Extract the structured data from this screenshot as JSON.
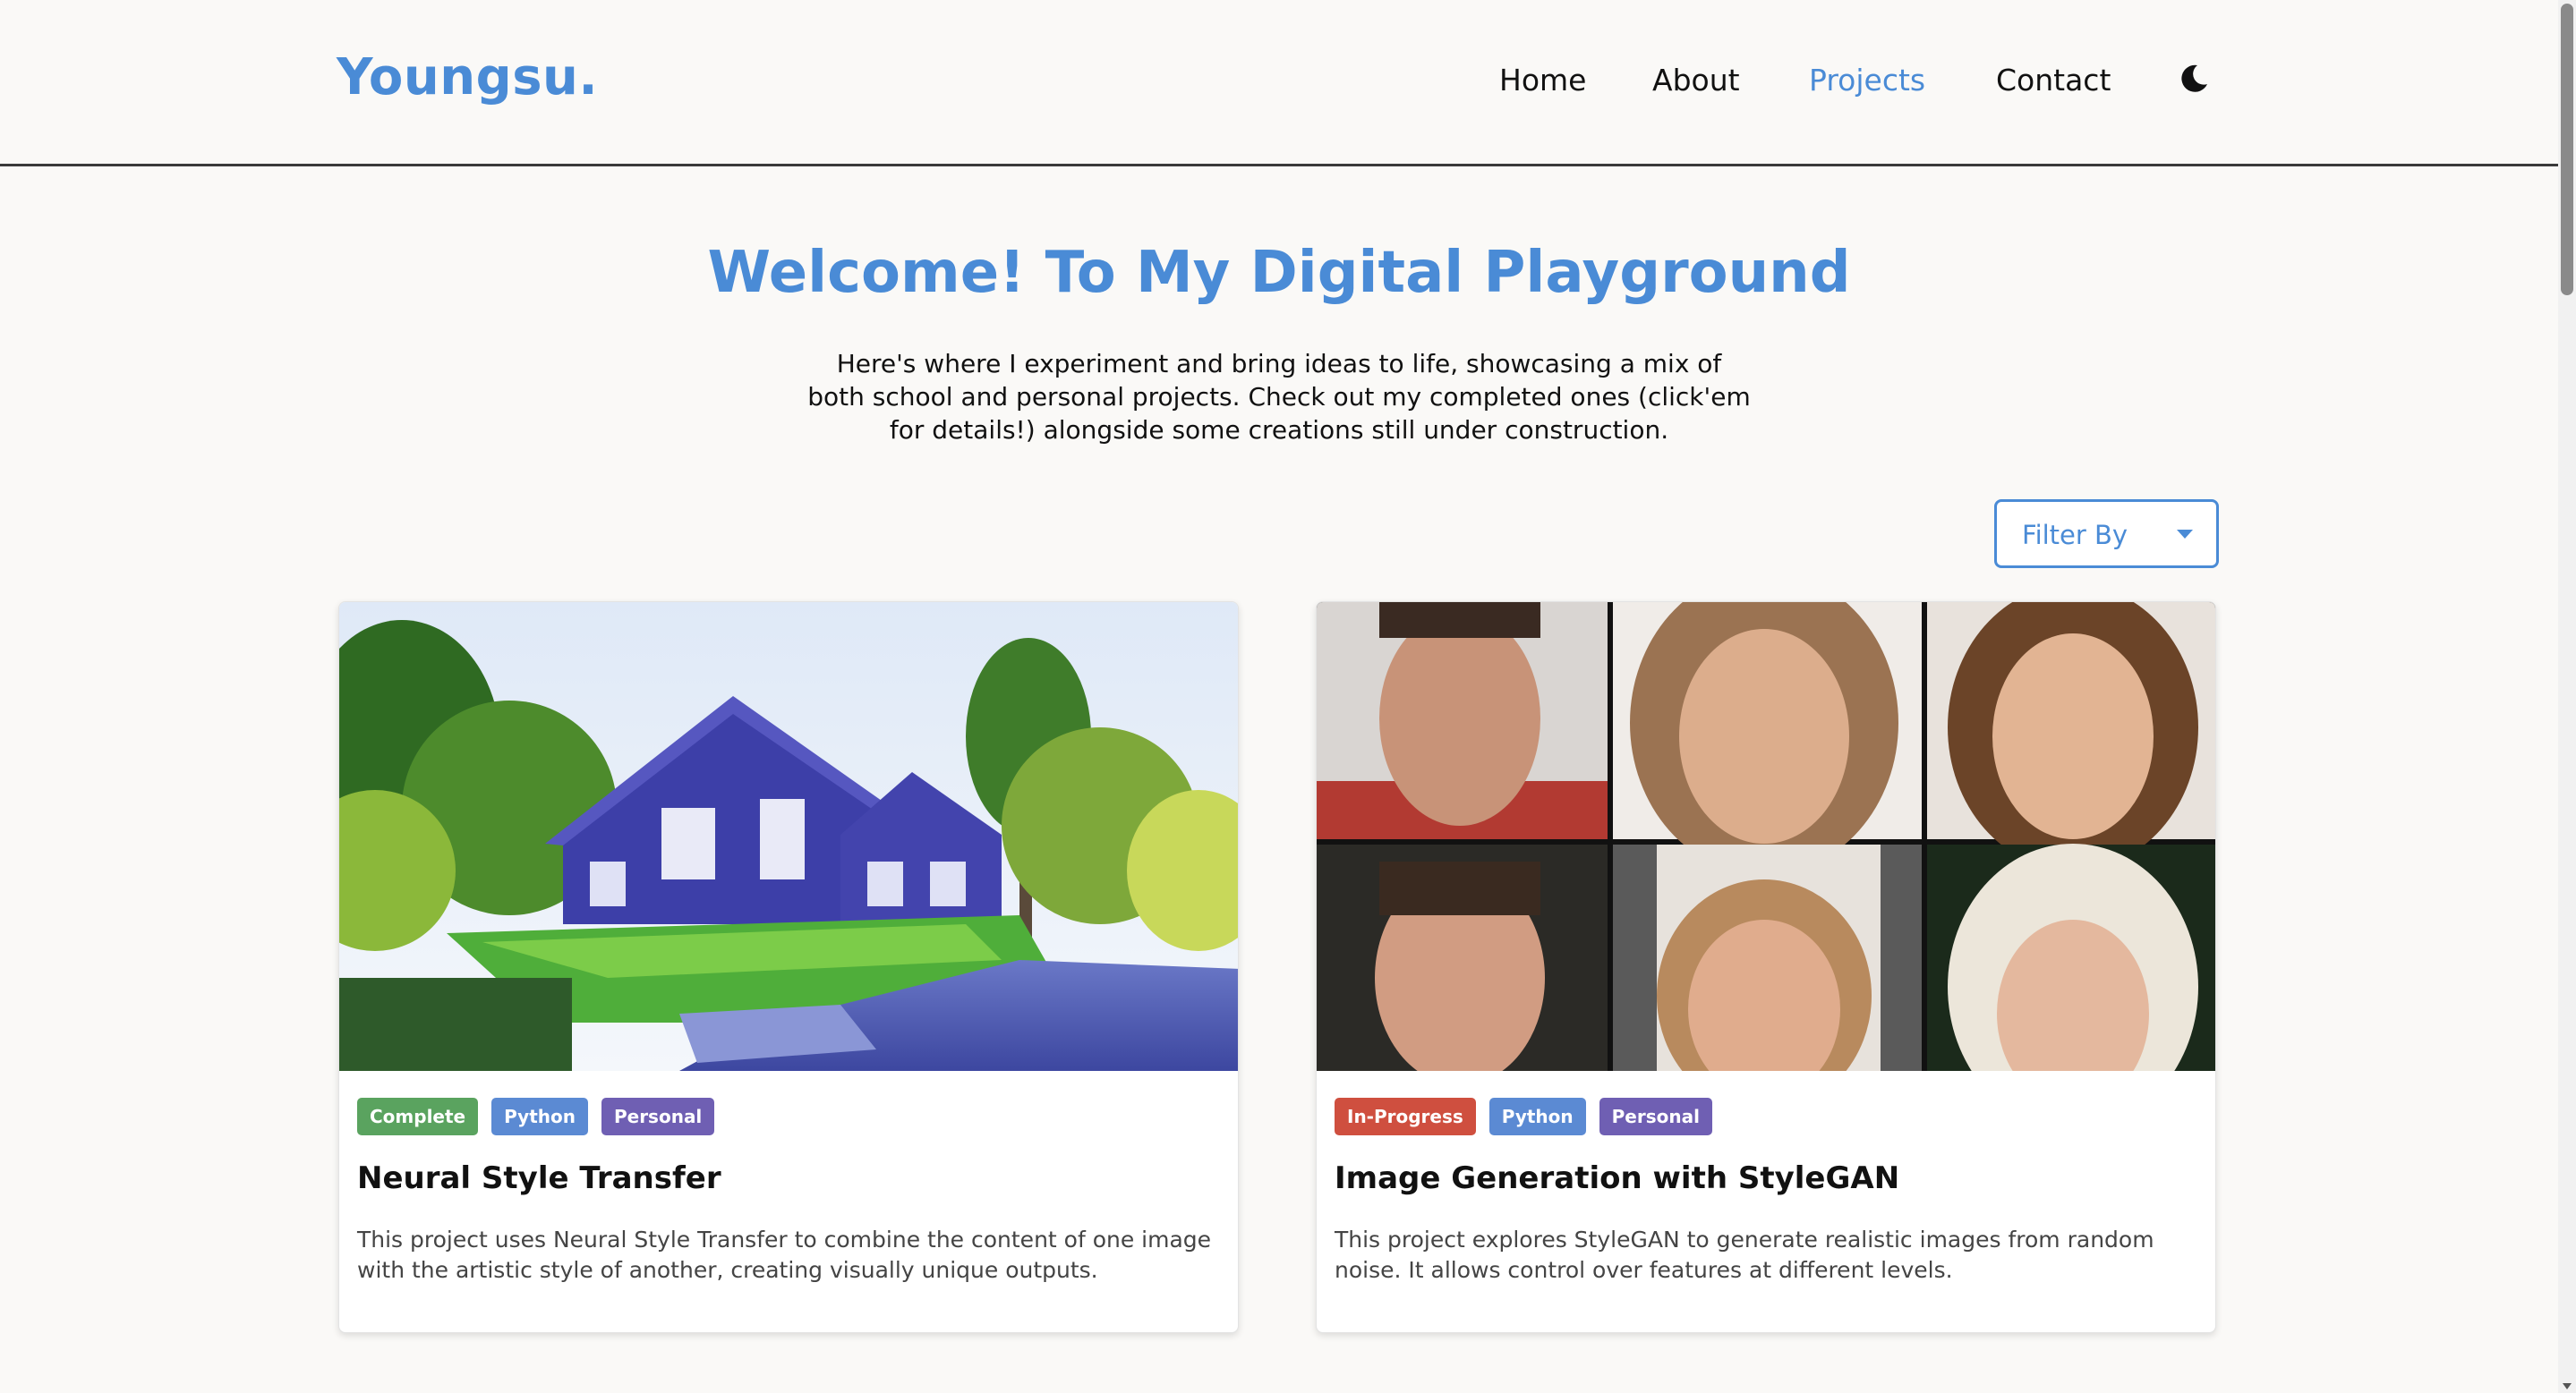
{
  "nav": {
    "brand": "Youngsu.",
    "links": [
      {
        "label": "Home"
      },
      {
        "label": "About"
      },
      {
        "label": "Projects",
        "active": true
      },
      {
        "label": "Contact"
      }
    ],
    "theme_toggle_icon": "moon-icon"
  },
  "hero": {
    "title": "Welcome! To My Digital Playground",
    "description": "Here's where I experiment and bring ideas to life, showcasing a mix of both school and personal projects. Check out my completed ones (click'em for details!) alongside some creations still under construction."
  },
  "filter": {
    "label": "Filter By",
    "icon": "caret-down-icon"
  },
  "projects": [
    {
      "image_description": "stylized painting of a lakeside house",
      "tags": [
        {
          "label": "Complete",
          "color": "#5aa35f"
        },
        {
          "label": "Python",
          "color": "#5b8ad3"
        },
        {
          "label": "Personal",
          "color": "#6f5fb3"
        }
      ],
      "title": "Neural Style Transfer",
      "description": "This project uses Neural Style Transfer to combine the content of one image with the artistic style of another, creating visually unique outputs."
    },
    {
      "image_description": "grid of six generated faces",
      "tags": [
        {
          "label": "In-Progress",
          "color": "#cf4f3f"
        },
        {
          "label": "Python",
          "color": "#5b8ad3"
        },
        {
          "label": "Personal",
          "color": "#6f5fb3"
        }
      ],
      "title": "Image Generation with StyleGAN",
      "description": "This project explores StyleGAN to generate realistic images from random noise. It allows control over features at different levels."
    }
  ],
  "colors": {
    "accent": "#4a8bd6",
    "background": "#faf9f7"
  }
}
